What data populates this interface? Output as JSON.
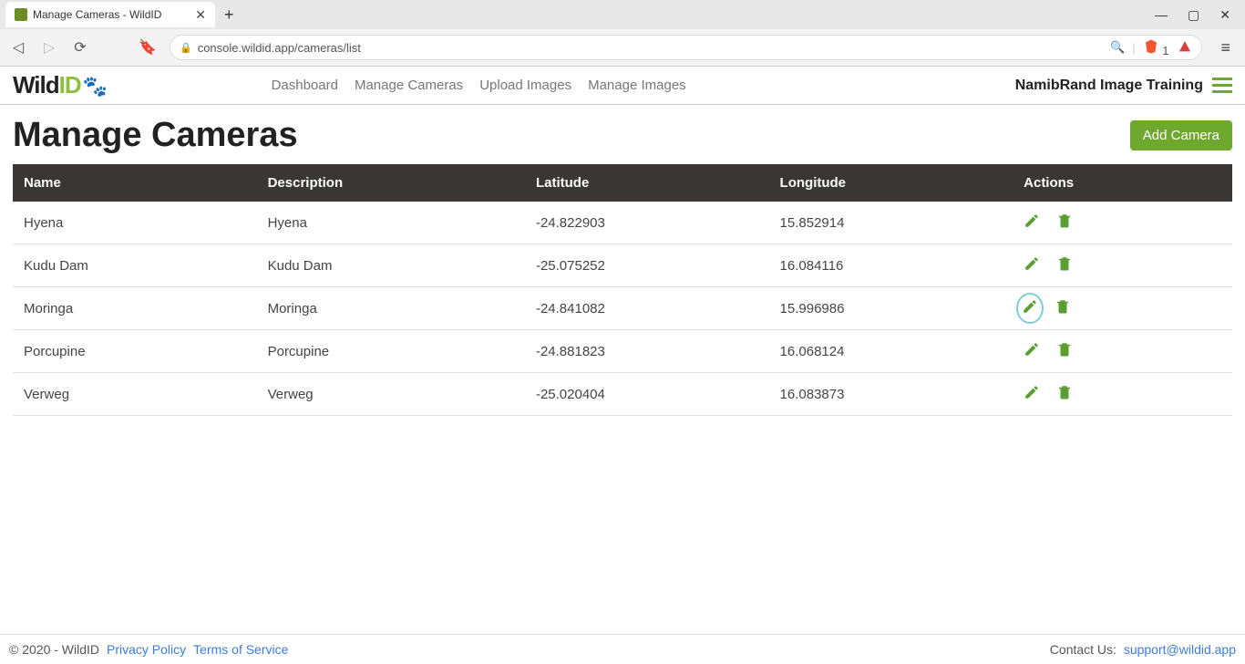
{
  "browser": {
    "tab_title": "Manage Cameras - WildID",
    "url": "console.wildid.app/cameras/list",
    "brave_badge": "1"
  },
  "logo": {
    "part1": "Wild",
    "part2": "ID"
  },
  "topnav": [
    "Dashboard",
    "Manage Cameras",
    "Upload Images",
    "Manage Images"
  ],
  "project_name": "NamibRand Image Training",
  "page": {
    "title": "Manage Cameras",
    "add_button": "Add Camera"
  },
  "table": {
    "headers": [
      "Name",
      "Description",
      "Latitude",
      "Longitude",
      "Actions"
    ],
    "rows": [
      {
        "name": "Hyena",
        "description": "Hyena",
        "latitude": "-24.822903",
        "longitude": "15.852914",
        "highlight": false
      },
      {
        "name": "Kudu Dam",
        "description": "Kudu Dam",
        "latitude": "-25.075252",
        "longitude": "16.084116",
        "highlight": false
      },
      {
        "name": "Moringa",
        "description": "Moringa",
        "latitude": "-24.841082",
        "longitude": "15.996986",
        "highlight": true
      },
      {
        "name": "Porcupine",
        "description": "Porcupine",
        "latitude": "-24.881823",
        "longitude": "16.068124",
        "highlight": false
      },
      {
        "name": "Verweg",
        "description": "Verweg",
        "latitude": "-25.020404",
        "longitude": "16.083873",
        "highlight": false
      }
    ]
  },
  "footer": {
    "copyright": "© 2020 - WildID",
    "privacy": "Privacy Policy",
    "terms": "Terms of Service",
    "contact_label": "Contact Us: ",
    "contact_email": "support@wildid.app"
  }
}
